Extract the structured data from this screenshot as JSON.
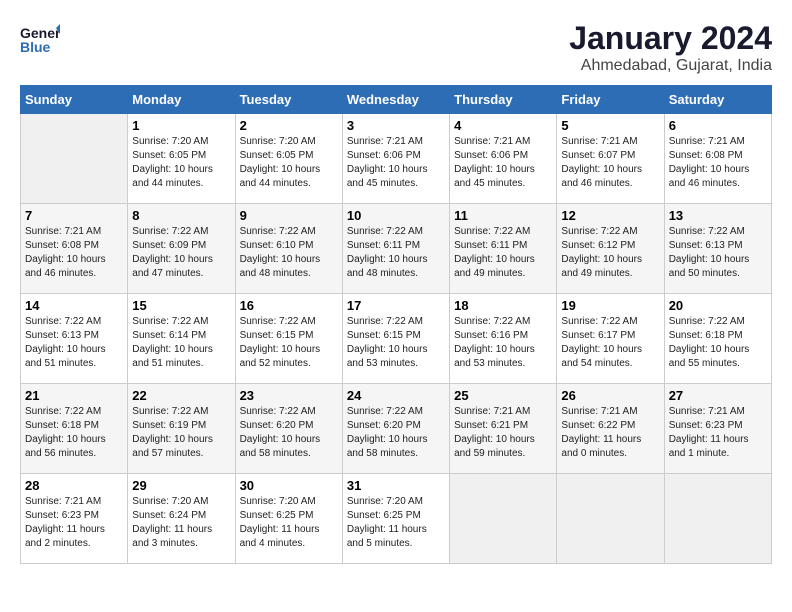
{
  "header": {
    "logo": {
      "line1": "General",
      "line2": "Blue"
    },
    "title": "January 2024",
    "location": "Ahmedabad, Gujarat, India"
  },
  "calendar": {
    "days_of_week": [
      "Sunday",
      "Monday",
      "Tuesday",
      "Wednesday",
      "Thursday",
      "Friday",
      "Saturday"
    ],
    "weeks": [
      [
        {
          "day": "",
          "sunrise": "",
          "sunset": "",
          "daylight": "",
          "empty": true
        },
        {
          "day": "1",
          "sunrise": "Sunrise: 7:20 AM",
          "sunset": "Sunset: 6:05 PM",
          "daylight": "Daylight: 10 hours and 44 minutes.",
          "empty": false
        },
        {
          "day": "2",
          "sunrise": "Sunrise: 7:20 AM",
          "sunset": "Sunset: 6:05 PM",
          "daylight": "Daylight: 10 hours and 44 minutes.",
          "empty": false
        },
        {
          "day": "3",
          "sunrise": "Sunrise: 7:21 AM",
          "sunset": "Sunset: 6:06 PM",
          "daylight": "Daylight: 10 hours and 45 minutes.",
          "empty": false
        },
        {
          "day": "4",
          "sunrise": "Sunrise: 7:21 AM",
          "sunset": "Sunset: 6:06 PM",
          "daylight": "Daylight: 10 hours and 45 minutes.",
          "empty": false
        },
        {
          "day": "5",
          "sunrise": "Sunrise: 7:21 AM",
          "sunset": "Sunset: 6:07 PM",
          "daylight": "Daylight: 10 hours and 46 minutes.",
          "empty": false
        },
        {
          "day": "6",
          "sunrise": "Sunrise: 7:21 AM",
          "sunset": "Sunset: 6:08 PM",
          "daylight": "Daylight: 10 hours and 46 minutes.",
          "empty": false
        }
      ],
      [
        {
          "day": "7",
          "sunrise": "Sunrise: 7:21 AM",
          "sunset": "Sunset: 6:08 PM",
          "daylight": "Daylight: 10 hours and 46 minutes.",
          "empty": false
        },
        {
          "day": "8",
          "sunrise": "Sunrise: 7:22 AM",
          "sunset": "Sunset: 6:09 PM",
          "daylight": "Daylight: 10 hours and 47 minutes.",
          "empty": false
        },
        {
          "day": "9",
          "sunrise": "Sunrise: 7:22 AM",
          "sunset": "Sunset: 6:10 PM",
          "daylight": "Daylight: 10 hours and 48 minutes.",
          "empty": false
        },
        {
          "day": "10",
          "sunrise": "Sunrise: 7:22 AM",
          "sunset": "Sunset: 6:11 PM",
          "daylight": "Daylight: 10 hours and 48 minutes.",
          "empty": false
        },
        {
          "day": "11",
          "sunrise": "Sunrise: 7:22 AM",
          "sunset": "Sunset: 6:11 PM",
          "daylight": "Daylight: 10 hours and 49 minutes.",
          "empty": false
        },
        {
          "day": "12",
          "sunrise": "Sunrise: 7:22 AM",
          "sunset": "Sunset: 6:12 PM",
          "daylight": "Daylight: 10 hours and 49 minutes.",
          "empty": false
        },
        {
          "day": "13",
          "sunrise": "Sunrise: 7:22 AM",
          "sunset": "Sunset: 6:13 PM",
          "daylight": "Daylight: 10 hours and 50 minutes.",
          "empty": false
        }
      ],
      [
        {
          "day": "14",
          "sunrise": "Sunrise: 7:22 AM",
          "sunset": "Sunset: 6:13 PM",
          "daylight": "Daylight: 10 hours and 51 minutes.",
          "empty": false
        },
        {
          "day": "15",
          "sunrise": "Sunrise: 7:22 AM",
          "sunset": "Sunset: 6:14 PM",
          "daylight": "Daylight: 10 hours and 51 minutes.",
          "empty": false
        },
        {
          "day": "16",
          "sunrise": "Sunrise: 7:22 AM",
          "sunset": "Sunset: 6:15 PM",
          "daylight": "Daylight: 10 hours and 52 minutes.",
          "empty": false
        },
        {
          "day": "17",
          "sunrise": "Sunrise: 7:22 AM",
          "sunset": "Sunset: 6:15 PM",
          "daylight": "Daylight: 10 hours and 53 minutes.",
          "empty": false
        },
        {
          "day": "18",
          "sunrise": "Sunrise: 7:22 AM",
          "sunset": "Sunset: 6:16 PM",
          "daylight": "Daylight: 10 hours and 53 minutes.",
          "empty": false
        },
        {
          "day": "19",
          "sunrise": "Sunrise: 7:22 AM",
          "sunset": "Sunset: 6:17 PM",
          "daylight": "Daylight: 10 hours and 54 minutes.",
          "empty": false
        },
        {
          "day": "20",
          "sunrise": "Sunrise: 7:22 AM",
          "sunset": "Sunset: 6:18 PM",
          "daylight": "Daylight: 10 hours and 55 minutes.",
          "empty": false
        }
      ],
      [
        {
          "day": "21",
          "sunrise": "Sunrise: 7:22 AM",
          "sunset": "Sunset: 6:18 PM",
          "daylight": "Daylight: 10 hours and 56 minutes.",
          "empty": false
        },
        {
          "day": "22",
          "sunrise": "Sunrise: 7:22 AM",
          "sunset": "Sunset: 6:19 PM",
          "daylight": "Daylight: 10 hours and 57 minutes.",
          "empty": false
        },
        {
          "day": "23",
          "sunrise": "Sunrise: 7:22 AM",
          "sunset": "Sunset: 6:20 PM",
          "daylight": "Daylight: 10 hours and 58 minutes.",
          "empty": false
        },
        {
          "day": "24",
          "sunrise": "Sunrise: 7:22 AM",
          "sunset": "Sunset: 6:20 PM",
          "daylight": "Daylight: 10 hours and 58 minutes.",
          "empty": false
        },
        {
          "day": "25",
          "sunrise": "Sunrise: 7:21 AM",
          "sunset": "Sunset: 6:21 PM",
          "daylight": "Daylight: 10 hours and 59 minutes.",
          "empty": false
        },
        {
          "day": "26",
          "sunrise": "Sunrise: 7:21 AM",
          "sunset": "Sunset: 6:22 PM",
          "daylight": "Daylight: 11 hours and 0 minutes.",
          "empty": false
        },
        {
          "day": "27",
          "sunrise": "Sunrise: 7:21 AM",
          "sunset": "Sunset: 6:23 PM",
          "daylight": "Daylight: 11 hours and 1 minute.",
          "empty": false
        }
      ],
      [
        {
          "day": "28",
          "sunrise": "Sunrise: 7:21 AM",
          "sunset": "Sunset: 6:23 PM",
          "daylight": "Daylight: 11 hours and 2 minutes.",
          "empty": false
        },
        {
          "day": "29",
          "sunrise": "Sunrise: 7:20 AM",
          "sunset": "Sunset: 6:24 PM",
          "daylight": "Daylight: 11 hours and 3 minutes.",
          "empty": false
        },
        {
          "day": "30",
          "sunrise": "Sunrise: 7:20 AM",
          "sunset": "Sunset: 6:25 PM",
          "daylight": "Daylight: 11 hours and 4 minutes.",
          "empty": false
        },
        {
          "day": "31",
          "sunrise": "Sunrise: 7:20 AM",
          "sunset": "Sunset: 6:25 PM",
          "daylight": "Daylight: 11 hours and 5 minutes.",
          "empty": false
        },
        {
          "day": "",
          "sunrise": "",
          "sunset": "",
          "daylight": "",
          "empty": true
        },
        {
          "day": "",
          "sunrise": "",
          "sunset": "",
          "daylight": "",
          "empty": true
        },
        {
          "day": "",
          "sunrise": "",
          "sunset": "",
          "daylight": "",
          "empty": true
        }
      ]
    ]
  }
}
